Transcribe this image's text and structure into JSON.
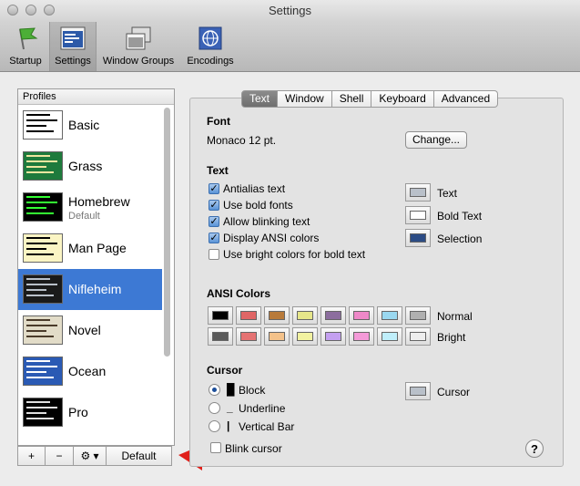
{
  "window": {
    "title": "Settings"
  },
  "toolbar": [
    {
      "label": "Startup",
      "icon": "startup-flag-icon"
    },
    {
      "label": "Settings",
      "icon": "settings-terminal-icon",
      "selected": true
    },
    {
      "label": "Window Groups",
      "icon": "window-groups-icon"
    },
    {
      "label": "Encodings",
      "icon": "encodings-globe-icon"
    }
  ],
  "profiles": {
    "header": "Profiles",
    "items": [
      {
        "name": "Basic",
        "bg": "#ffffff",
        "fg": "#000000"
      },
      {
        "name": "Grass",
        "bg": "#1e7a3c",
        "fg": "#f0e6a0"
      },
      {
        "name": "Homebrew",
        "subtitle": "Default",
        "bg": "#000000",
        "fg": "#33ff33"
      },
      {
        "name": "Man Page",
        "bg": "#fbf5c4",
        "fg": "#000000"
      },
      {
        "name": "Nifleheim",
        "bg": "#1a1a1a",
        "fg": "#b9c0c9",
        "selected": true
      },
      {
        "name": "Novel",
        "bg": "#e2dcc8",
        "fg": "#4a3b2a"
      },
      {
        "name": "Ocean",
        "bg": "#2a5ab4",
        "fg": "#ffffff"
      },
      {
        "name": "Pro",
        "bg": "#000000",
        "fg": "#e0e0e0"
      }
    ],
    "buttons": {
      "add": "+",
      "remove": "−",
      "gear": "⚙ ▾",
      "default": "Default"
    }
  },
  "tabs": [
    {
      "label": "Text",
      "selected": true
    },
    {
      "label": "Window"
    },
    {
      "label": "Shell"
    },
    {
      "label": "Keyboard"
    },
    {
      "label": "Advanced"
    }
  ],
  "font": {
    "heading": "Font",
    "value": "Monaco 12 pt.",
    "change_button": "Change..."
  },
  "text": {
    "heading": "Text",
    "options": [
      {
        "label": "Antialias text",
        "checked": true
      },
      {
        "label": "Use bold fonts",
        "checked": true
      },
      {
        "label": "Allow blinking text",
        "checked": true
      },
      {
        "label": "Display ANSI colors",
        "checked": true
      },
      {
        "label": "Use bright colors for bold text",
        "checked": false
      }
    ],
    "colors": [
      {
        "label": "Text",
        "color": "#b9c0c9"
      },
      {
        "label": "Bold Text",
        "color": "#ffffff"
      },
      {
        "label": "Selection",
        "color": "#2c4c85"
      }
    ]
  },
  "ansi": {
    "heading": "ANSI Colors",
    "normal_label": "Normal",
    "bright_label": "Bright",
    "normal": [
      "#000000",
      "#e06666",
      "#b87a3a",
      "#e6e68a",
      "#8c6e9e",
      "#ee88c8",
      "#9ad8f0",
      "#b0b0b0"
    ],
    "bright": [
      "#5a5a5a",
      "#e57373",
      "#f4c28a",
      "#f2f2a0",
      "#c4a0f0",
      "#f49ad8",
      "#bfeefa",
      "#eeeeee"
    ]
  },
  "cursor": {
    "heading": "Cursor",
    "options": [
      {
        "glyph": "█",
        "label": "Block",
        "selected": true
      },
      {
        "glyph": "_",
        "label": "Underline",
        "selected": false
      },
      {
        "glyph": "|",
        "label": "Vertical Bar",
        "selected": false
      }
    ],
    "blink_label": "Blink cursor",
    "blink_checked": false,
    "color_label": "Cursor",
    "color": "#b9c0c9"
  },
  "help": "?",
  "annotation": {
    "color": "#e0201a"
  }
}
